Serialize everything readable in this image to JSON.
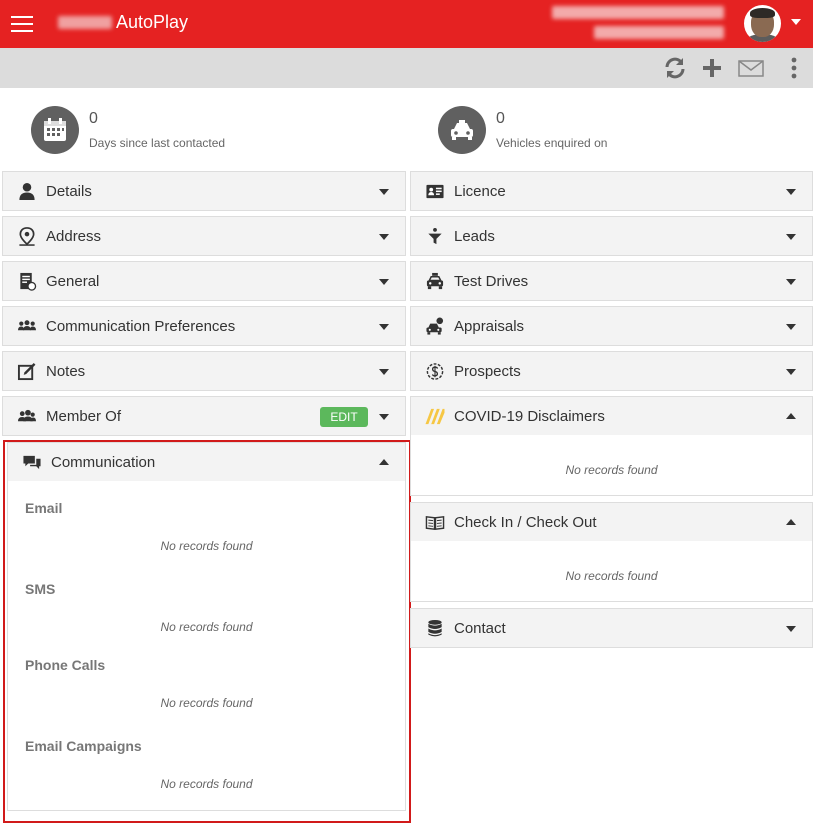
{
  "header": {
    "app_title": "AutoPlay",
    "brand_color": "#e52222",
    "menu_icon": "hamburger-menu-icon",
    "avatar_icon": "user-avatar"
  },
  "toolbar": {
    "icons": [
      "refresh-icon",
      "add-icon",
      "email-icon",
      "more-vertical-icon"
    ]
  },
  "stats": {
    "days_since_contacted": {
      "value": "0",
      "label": "Days since last contacted",
      "icon": "calendar-icon"
    },
    "vehicles_enquired": {
      "value": "0",
      "label": "Vehicles enquired on",
      "icon": "car-icon"
    }
  },
  "left_panels": [
    {
      "title": "Details",
      "icon": "person-icon",
      "state": "collapsed"
    },
    {
      "title": "Address",
      "icon": "map-pin-icon",
      "state": "collapsed"
    },
    {
      "title": "General",
      "icon": "document-icon",
      "state": "collapsed"
    },
    {
      "title": "Communication Preferences",
      "icon": "group-icon",
      "state": "collapsed"
    },
    {
      "title": "Notes",
      "icon": "edit-note-icon",
      "state": "collapsed"
    },
    {
      "title": "Member Of",
      "icon": "users-icon",
      "state": "collapsed",
      "badge": "EDIT"
    },
    {
      "title": "Communication",
      "icon": "chat-icon",
      "state": "expanded"
    }
  ],
  "communication": {
    "sections": [
      {
        "label": "Email",
        "empty_text": "No records found"
      },
      {
        "label": "SMS",
        "empty_text": "No records found"
      },
      {
        "label": "Phone Calls",
        "empty_text": "No records found"
      },
      {
        "label": "Email Campaigns",
        "empty_text": "No records found"
      }
    ]
  },
  "right_panels": [
    {
      "title": "Licence",
      "icon": "id-card-icon",
      "state": "collapsed"
    },
    {
      "title": "Leads",
      "icon": "funnel-icon",
      "state": "collapsed"
    },
    {
      "title": "Test Drives",
      "icon": "taxi-icon",
      "state": "collapsed"
    },
    {
      "title": "Appraisals",
      "icon": "car-dollar-icon",
      "state": "collapsed"
    },
    {
      "title": "Prospects",
      "icon": "dollar-circle-icon",
      "state": "collapsed"
    },
    {
      "title": "COVID-19 Disclaimers",
      "icon": "warning-stripes-icon",
      "state": "expanded",
      "empty_text": "No records found"
    },
    {
      "title": "Check In / Check Out",
      "icon": "open-book-icon",
      "state": "expanded",
      "empty_text": "No records found"
    },
    {
      "title": "Contact",
      "icon": "database-icon",
      "state": "collapsed"
    }
  ]
}
